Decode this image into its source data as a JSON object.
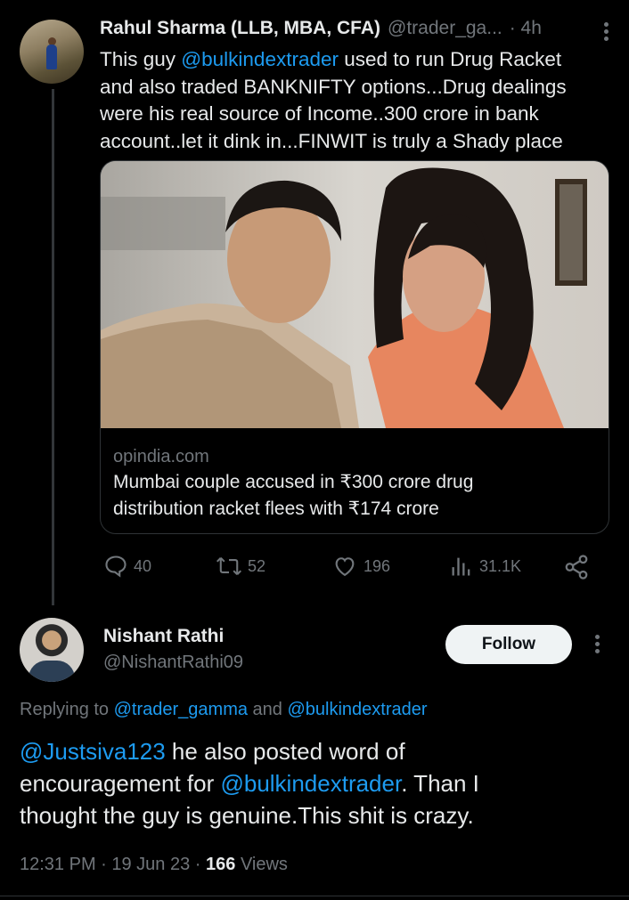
{
  "tweet": {
    "author_name": "Rahul Sharma (LLB, MBA, CFA)",
    "author_handle": "@trader_ga...",
    "time": "· 4h",
    "text_parts": {
      "l1_pre": "This guy ",
      "l1_mention": "@bulkindextrader",
      "l1_post": " used to run Drug Racket",
      "l2": "and also traded BANKNIFTY options...Drug dealings",
      "l3": "were his real source of Income..300 crore in bank",
      "l4": "account..let it dink in...FINWIT is truly a Shady place"
    },
    "card": {
      "domain": "opindia.com",
      "title_l1": "Mumbai couple accused in ₹300 crore drug",
      "title_l2": "distribution racket flees with ₹174 crore"
    },
    "stats": {
      "replies": "40",
      "retweets": "52",
      "likes": "196",
      "views": "31.1K"
    }
  },
  "reply": {
    "author_name": "Nishant Rathi",
    "author_handle": "@NishantRathi09",
    "follow_label": "Follow",
    "replying_prefix": "Replying to ",
    "replying_user1": "@trader_gamma",
    "replying_and": " and ",
    "replying_user2": "@bulkindextrader",
    "text": {
      "l1_mention": "@Justsiva123",
      "l1_post": " he also posted word of",
      "l2_pre": "encouragement for ",
      "l2_mention": "@bulkindextrader",
      "l2_post": ". Than I",
      "l3": "thought the guy is genuine.This shit is crazy."
    },
    "timestamp": "12:31 PM · 19 Jun 23 · ",
    "views_count": "166",
    "views_label": " Views"
  },
  "colors": {
    "accent": "#1d9bf0",
    "muted": "#71767b",
    "text": "#e7e9ea",
    "background": "#000000"
  },
  "icons": [
    "reply-icon",
    "retweet-icon",
    "like-icon",
    "views-icon",
    "share-icon",
    "more-icon"
  ]
}
